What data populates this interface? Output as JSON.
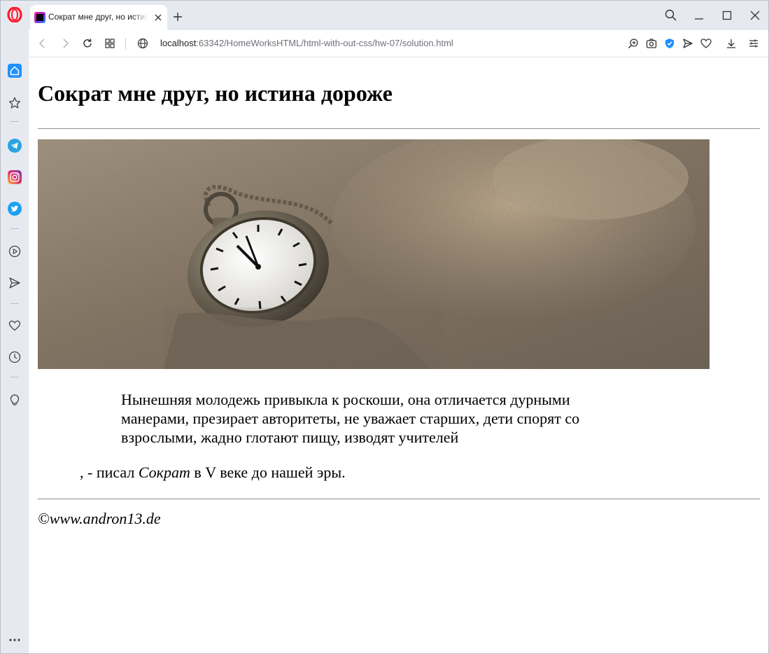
{
  "browser": {
    "tab": {
      "title": "Сократ мне друг, но истина дороже"
    },
    "address": {
      "host": "localhost",
      "rest": ":63342/HomeWorksHTML/html-with-out-css/hw-07/solution.html"
    },
    "colors": {
      "opera_red": "#ff1b2d",
      "accent_blue": "#1e90ff",
      "chrome_bg": "#e6eaf0"
    }
  },
  "sidebar": {
    "items": [
      "home-icon",
      "star-icon",
      "telegram-icon",
      "instagram-icon",
      "twitter-icon",
      "player-icon",
      "send-icon",
      "heart-icon",
      "history-icon",
      "lightbulb-icon",
      "more-icon"
    ]
  },
  "page": {
    "heading": "Сократ мне друг, но истина дороже",
    "quote": "Нынешняя молодежь привыкла к роскоши, она отличается дурными манерами, презирает авторитеты, не уважает старших, дети спорят со взрослыми, жадно глотают пищу, изводят учителей",
    "attribution": {
      "prefix": ", - писал ",
      "author": "Сократ",
      "suffix": " в V веке до нашей эры."
    },
    "footer": "©www.andron13.de"
  }
}
